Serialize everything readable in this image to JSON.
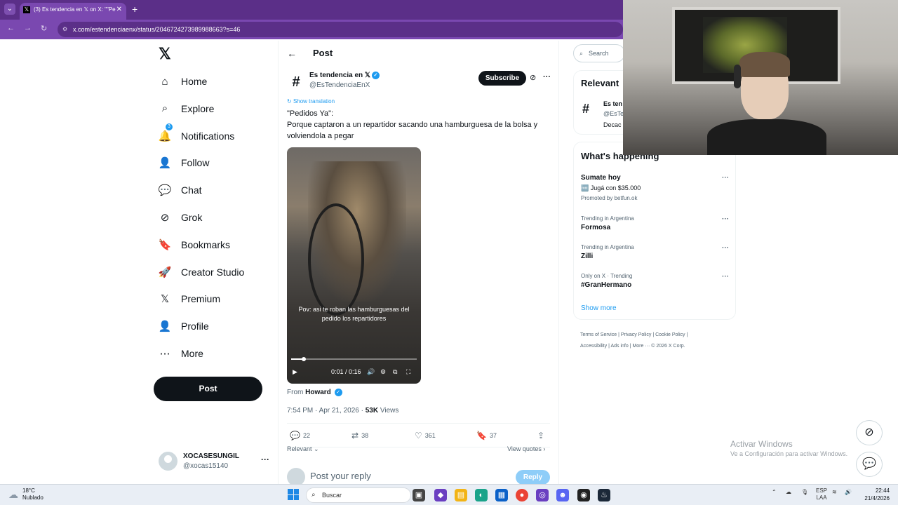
{
  "browser": {
    "tab_title": "(3) Es tendencia en 𝕏 on X: \"\"Pe",
    "favicon": "𝕏",
    "url": "x.com/estendenciaenx/status/2046724273989988663?s=46"
  },
  "nav": {
    "logo": "𝕏",
    "items": [
      {
        "label": "Home",
        "icon": "⌂"
      },
      {
        "label": "Explore",
        "icon": "⌕"
      },
      {
        "label": "Notifications",
        "icon": "🔔",
        "badge": "3"
      },
      {
        "label": "Follow",
        "icon": "👤"
      },
      {
        "label": "Chat",
        "icon": "💬"
      },
      {
        "label": "Grok",
        "icon": "⊘"
      },
      {
        "label": "Bookmarks",
        "icon": "🔖"
      },
      {
        "label": "Creator Studio",
        "icon": "🚀"
      },
      {
        "label": "Premium",
        "icon": "𝕏"
      },
      {
        "label": "Profile",
        "icon": "👤"
      },
      {
        "label": "More",
        "icon": "⋯"
      }
    ],
    "post_button": "Post",
    "account": {
      "name": "XOCASESUNGIL",
      "handle": "@xocas15140"
    }
  },
  "post": {
    "header": "Post",
    "author_name": "Es tendencia en 𝕏",
    "author_handle": "@EsTendenciaEnX",
    "avatar_glyph": "#",
    "subscribe": "Subscribe",
    "show_translation": "Show translation",
    "text_line1": "\"Pedidos Ya\":",
    "text_line2": "Porque captaron a un repartidor sacando una hamburguesa de la bolsa y volviendola a pegar",
    "video": {
      "subtitle": "Pov: asi te roban las hamburguesas del pedido los repartidores",
      "time": "0:01 / 0:16",
      "progress": 0.1
    },
    "from_label": "From",
    "from_name": "Howard",
    "timestamp": "7:54 PM · Apr 21, 2026 · ",
    "views_count": "53K",
    "views_label": " Views",
    "stats": {
      "replies": "22",
      "reposts": "38",
      "likes": "361",
      "bookmarks": "37"
    },
    "relevant": "Relevant",
    "view_quotes": "View quotes",
    "reply_placeholder": "Post your reply",
    "reply_button": "Reply"
  },
  "sidebar": {
    "search_placeholder": "Search",
    "relevant_header": "Relevant",
    "relevant_name": "Es ten",
    "relevant_handle": "@EsTe",
    "relevant_desc": "Decac",
    "happening_header": "What's happening",
    "trends": [
      {
        "category": "",
        "name": "Sumate hoy",
        "promo": "🆓 Jugá con $35.000",
        "promo_by": "Promoted by betfun.ok"
      },
      {
        "category": "Trending in Argentina",
        "name": "Formosa"
      },
      {
        "category": "Trending in Argentina",
        "name": "Zilli"
      },
      {
        "category": "Only on X · Trending",
        "name": "#GranHermano"
      }
    ],
    "show_more": "Show more",
    "footer_line1": "Terms of Service  |  Privacy Policy  |  Cookie Policy  |",
    "footer_line2": "Accessibility  |  Ads info  |  More ···   © 2026 X Corp."
  },
  "windows": {
    "activate_title": "Activar Windows",
    "activate_sub": "Ve a Configuración para activar Windows.",
    "weather_temp": "18°C",
    "weather_desc": "Nublado",
    "taskbar_search": "Buscar",
    "lang_line1": "ESP",
    "lang_line2": "LAA",
    "time": "22:44",
    "date": "21/4/2026"
  }
}
